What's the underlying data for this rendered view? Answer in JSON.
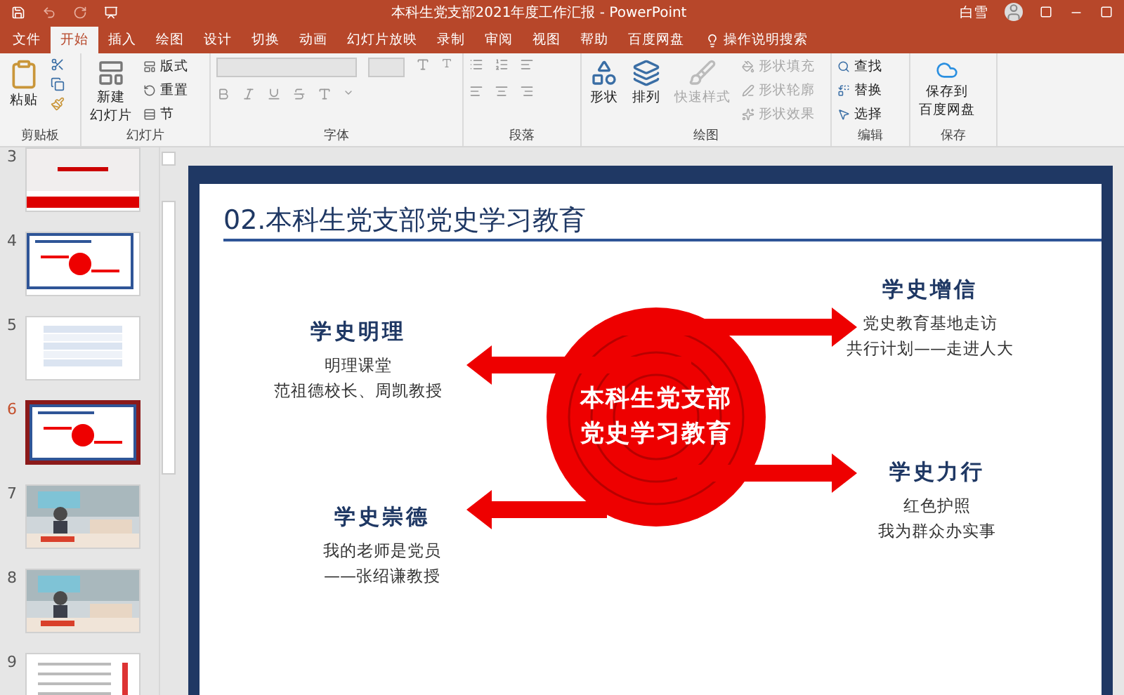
{
  "window": {
    "title": "本科生党支部2021年度工作汇报 - PowerPoint",
    "user": "白雪"
  },
  "tabs": [
    {
      "label": "文件",
      "selected": false
    },
    {
      "label": "开始",
      "selected": true
    },
    {
      "label": "插入",
      "selected": false
    },
    {
      "label": "绘图",
      "selected": false
    },
    {
      "label": "设计",
      "selected": false
    },
    {
      "label": "切换",
      "selected": false
    },
    {
      "label": "动画",
      "selected": false
    },
    {
      "label": "幻灯片放映",
      "selected": false
    },
    {
      "label": "录制",
      "selected": false
    },
    {
      "label": "审阅",
      "selected": false
    },
    {
      "label": "视图",
      "selected": false
    },
    {
      "label": "帮助",
      "selected": false
    },
    {
      "label": "百度网盘",
      "selected": false
    }
  ],
  "tell_me": {
    "placeholder": "操作说明搜索"
  },
  "ribbon": {
    "clipboard": {
      "label": "剪贴板",
      "paste": "粘贴"
    },
    "slides": {
      "label": "幻灯片",
      "new_slide": [
        "新建",
        "幻灯片"
      ],
      "items": [
        "版式",
        "重置",
        "节"
      ]
    },
    "font": {
      "label": "字体"
    },
    "paragraph": {
      "label": "段落"
    },
    "drawing": {
      "label": "绘图",
      "large": [
        {
          "label": "形状",
          "disabled": false
        },
        {
          "label": "排列",
          "disabled": false
        },
        {
          "label": "快速样式",
          "disabled": true
        }
      ],
      "items": [
        {
          "label": "形状填充",
          "disabled": true
        },
        {
          "label": "形状轮廓",
          "disabled": true
        },
        {
          "label": "形状效果",
          "disabled": true
        }
      ]
    },
    "editing": {
      "label": "编辑",
      "items": [
        "查找",
        "替换",
        "选择"
      ]
    },
    "save": {
      "label": "保存",
      "button": [
        "保存到",
        "百度网盘"
      ]
    }
  },
  "thumbnails": [
    {
      "number": "3",
      "kind": "title",
      "selected": false
    },
    {
      "number": "4",
      "kind": "diagram",
      "selected": false
    },
    {
      "number": "5",
      "kind": "table",
      "selected": false
    },
    {
      "number": "6",
      "kind": "diagram",
      "selected": true
    },
    {
      "number": "7",
      "selected": false
    },
    {
      "number": "8",
      "selected": false
    },
    {
      "number": "9",
      "kind": "text",
      "selected": false
    }
  ],
  "slide": {
    "heading": "02.本科生党支部党史学习教育",
    "center": [
      "本科生党支部",
      "党史学习教育"
    ],
    "blocks": [
      {
        "title": "学史明理",
        "lines": [
          "明理课堂",
          "范祖德校长、周凯教授"
        ]
      },
      {
        "title": "学史崇德",
        "lines": [
          "我的老师是党员",
          "——张绍谦教授"
        ]
      },
      {
        "title": "学史增信",
        "lines": [
          "党史教育基地走访",
          "共行计划——走进人大"
        ]
      },
      {
        "title": "学史力行",
        "lines": [
          "红色护照",
          "我为群众办实事"
        ]
      }
    ]
  }
}
